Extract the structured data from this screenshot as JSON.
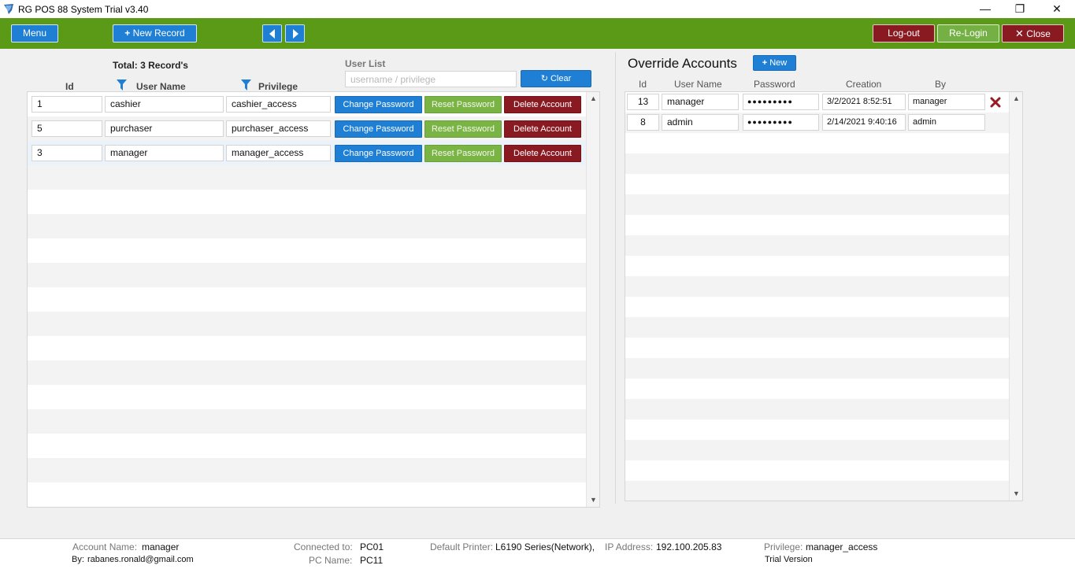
{
  "window": {
    "title": "RG POS 88 System Trial v3.40",
    "minimize": "—",
    "maximize": "❐",
    "close": "✕"
  },
  "toolbar": {
    "menu_label": "Menu",
    "new_record_label": "New Record",
    "logout_label": "Log-out",
    "relogin_label": "Re-Login",
    "close_label": "Close"
  },
  "users": {
    "total_label": "Total: 3 Record's",
    "list_label": "User List",
    "search_placeholder": "username / privilege",
    "clear_label": "Clear",
    "columns": {
      "id": "Id",
      "username": "User Name",
      "privilege": "Privilege"
    },
    "actions": {
      "change": "Change Password",
      "reset": "Reset Password",
      "delete": "Delete Account"
    },
    "rows": [
      {
        "id": "1",
        "username": "cashier",
        "privilege": "cashier_access"
      },
      {
        "id": "5",
        "username": "purchaser",
        "privilege": "purchaser_access"
      },
      {
        "id": "3",
        "username": "manager",
        "privilege": "manager_access"
      }
    ]
  },
  "override": {
    "title": "Override Accounts",
    "new_label": "New",
    "columns": {
      "id": "Id",
      "username": "User Name",
      "password": "Password",
      "creation": "Creation",
      "by": "By"
    },
    "rows": [
      {
        "id": "13",
        "username": "manager",
        "password": "●●●●●●●●●",
        "creation": "3/2/2021 8:52:51",
        "by": "manager"
      },
      {
        "id": "8",
        "username": "admin",
        "password": "●●●●●●●●●",
        "creation": "2/14/2021 9:40:16",
        "by": "admin"
      }
    ]
  },
  "status": {
    "account_name_label": "Account Name:",
    "account_name": "manager",
    "by_label": "By:",
    "by": "rabanes.ronald@gmail.com",
    "connected_label": "Connected to:",
    "connected": "PC01",
    "pc_name_label": "PC Name:",
    "pc_name": "PC11",
    "printer_label": "Default Printer:",
    "printer": "L6190 Series(Network),",
    "ip_label": "IP Address:",
    "ip": "192.100.205.83",
    "privilege_label": "Privilege:",
    "privilege": "manager_access",
    "version": "Trial Version"
  },
  "colors": {
    "toolbar_green": "#5a9a16",
    "primary_blue": "#1f7fd4",
    "danger_red": "#8a1a22",
    "success_green": "#7ab445"
  }
}
